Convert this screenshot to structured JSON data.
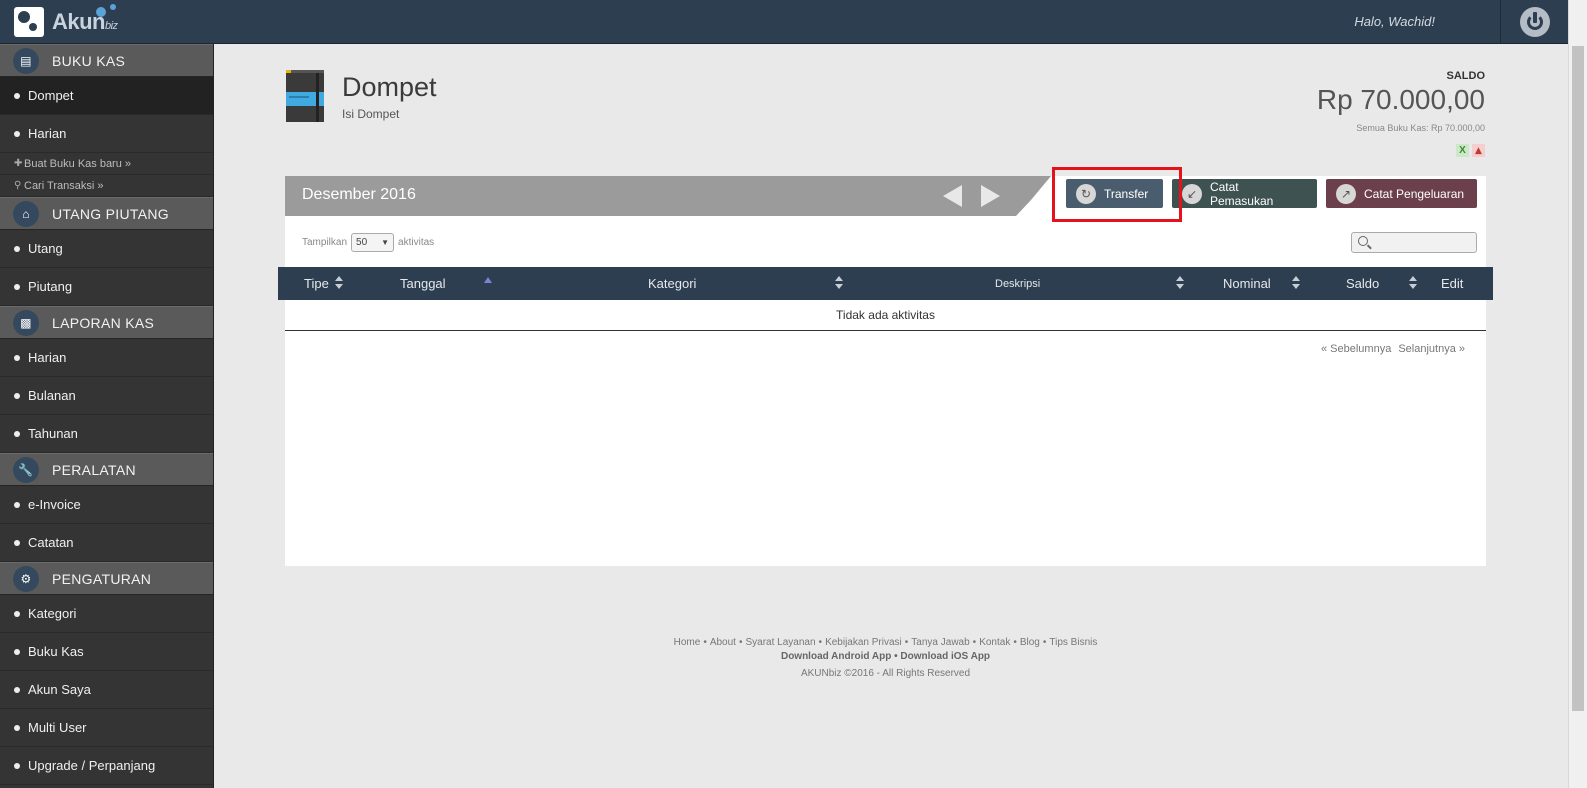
{
  "topbar": {
    "logo_text": "Akun",
    "logo_suffix": "biz",
    "greeting": "Halo, Wachid!"
  },
  "sidebar": {
    "sections": [
      {
        "title": "BUKU KAS",
        "icon": "book-icon",
        "items": [
          "Dompet",
          "Harian"
        ],
        "extras": [
          "Buat Buku Kas baru »",
          "Cari Transaksi »"
        ]
      },
      {
        "title": "UTANG PIUTANG",
        "icon": "bank-icon",
        "items": [
          "Utang",
          "Piutang"
        ]
      },
      {
        "title": "LAPORAN KAS",
        "icon": "bar-chart-icon",
        "items": [
          "Harian",
          "Bulanan",
          "Tahunan"
        ]
      },
      {
        "title": "PERALATAN",
        "icon": "wrench-icon",
        "items": [
          "e-Invoice",
          "Catatan"
        ]
      },
      {
        "title": "PENGATURAN",
        "icon": "gear-icon",
        "items": [
          "Kategori",
          "Buku Kas",
          "Akun Saya",
          "Multi User",
          "Upgrade / Perpanjang"
        ]
      }
    ]
  },
  "header": {
    "title": "Dompet",
    "subtitle": "Isi Dompet",
    "saldo_label": "SALDO",
    "saldo_amount": "Rp 70.000,00",
    "saldo_all": "Semua Buku Kas: Rp 70.000,00",
    "export_excel": "X"
  },
  "panel": {
    "month": "Desember 2016",
    "buttons": {
      "transfer": "Transfer",
      "pemasukan": "Catat Pemasukan",
      "pengeluaran": "Catat Pengeluaran"
    },
    "show_prefix": "Tampilkan",
    "show_value": "50",
    "show_suffix": "aktivitas",
    "columns": [
      "Tipe",
      "Tanggal",
      "Kategori",
      "Deskripsi",
      "Nominal",
      "Saldo",
      "Edit"
    ],
    "empty_message": "Tidak ada aktivitas",
    "prev": "« Sebelumnya",
    "next": "Selanjutnya »"
  },
  "footer": {
    "links": [
      "Home",
      "About",
      "Syarat Layanan",
      "Kebijakan Privasi",
      "Tanya Jawab",
      "Kontak",
      "Blog",
      "Tips Bisnis"
    ],
    "android": "Download Android App",
    "ios": "Download iOS App",
    "app_sep": "•",
    "copyright": "AKUNbiz ©2016 - All Rights Reserved"
  },
  "colors": {
    "topbar": "#2c3e50",
    "highlight": "#e3121b",
    "transfer_btn": "#4a5d6e",
    "pemasukan_btn": "#3e5251",
    "pengeluaran_btn": "#6b3f4b"
  }
}
